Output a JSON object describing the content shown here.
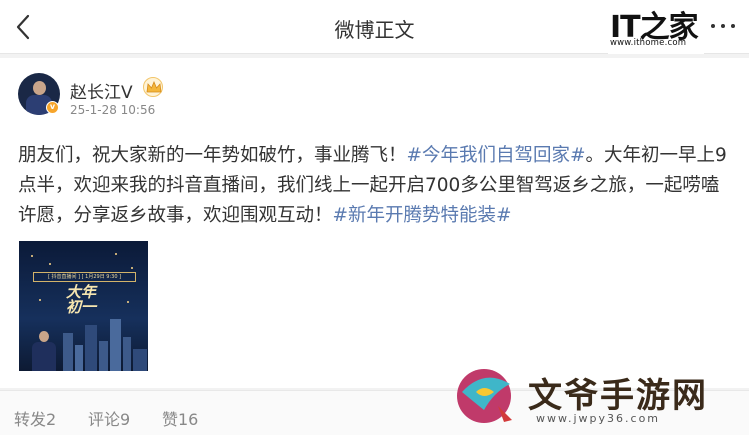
{
  "header": {
    "title": "微博正文",
    "watermark_url": "www.ithome.com"
  },
  "post": {
    "author": "赵长江V",
    "timestamp": "25-1-28 10:56",
    "text_before": "朋友们，祝大家新的一年势如破竹，事业腾飞！",
    "tag1": "#今年我们自驾回家#",
    "text_middle": "。大年初一早上9点半，欢迎来我的抖音直播间，我们线上一起开启700多公里智驾返乡之旅，一起唠嗑许愿，分享返乡故事，欢迎围观互动！",
    "tag2": "#新年开腾势特能装#",
    "image": {
      "band_text": "[ 抖音直播间 ] [ 1月29日 9:30 ]",
      "calligraphy": "大年初一"
    }
  },
  "actions": {
    "repost": "转发2",
    "comment": "评论9",
    "like": "赞16"
  },
  "watermark": {
    "site": "文爷手游网",
    "url": "www.jwpy36.com"
  },
  "colors": {
    "tag": "#5a7ab0",
    "muted": "#888888",
    "text": "#333333"
  }
}
